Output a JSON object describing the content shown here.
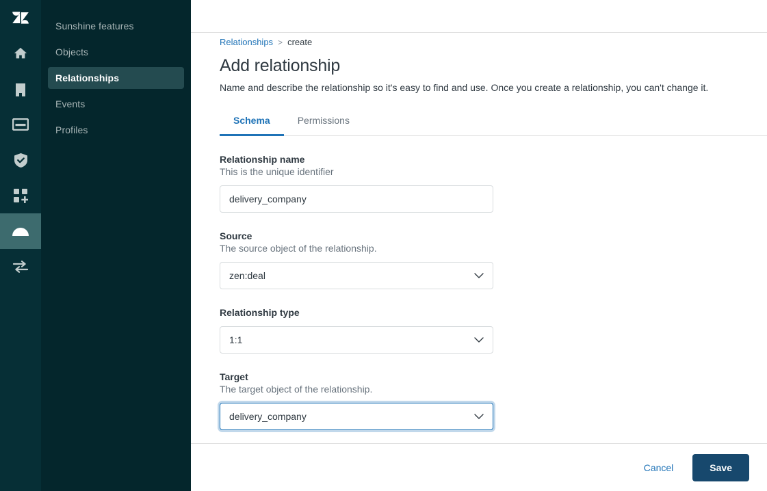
{
  "colors": {
    "rail_bg": "#062f36",
    "nav_bg": "#04262c",
    "nav_active_bg": "#244b50",
    "rail_active_bg": "#3d6b6e",
    "link_blue": "#1f73b7",
    "save_navy": "#17486d",
    "text_dark": "#2f3941",
    "text_muted": "#68737d",
    "border": "#d8dcde"
  },
  "rail": {
    "logo_name": "zendesk-logo",
    "items": [
      {
        "icon": "home-icon",
        "active": false
      },
      {
        "icon": "organization-icon",
        "active": false
      },
      {
        "icon": "card-icon",
        "active": false
      },
      {
        "icon": "shield-check-icon",
        "active": false
      },
      {
        "icon": "apps-add-icon",
        "active": false
      },
      {
        "icon": "sunshine-icon",
        "active": true
      },
      {
        "icon": "arrows-exchange-icon",
        "active": false
      }
    ]
  },
  "sidebar": {
    "items": [
      {
        "label": "Sunshine features",
        "active": false
      },
      {
        "label": "Objects",
        "active": false
      },
      {
        "label": "Relationships",
        "active": true
      },
      {
        "label": "Events",
        "active": false
      },
      {
        "label": "Profiles",
        "active": false
      }
    ]
  },
  "breadcrumb": {
    "link": "Relationships",
    "separator": ">",
    "current": "create"
  },
  "page": {
    "title": "Add relationship",
    "description": "Name and describe the relationship so it's easy to find and use. Once you create a relationship, you can't change it."
  },
  "tabs": [
    {
      "label": "Schema",
      "active": true
    },
    {
      "label": "Permissions",
      "active": false
    }
  ],
  "form": {
    "name_field": {
      "label": "Relationship name",
      "hint": "This is the unique identifier",
      "value": "delivery_company",
      "placeholder": ""
    },
    "source_field": {
      "label": "Source",
      "hint": "The source object of the relationship.",
      "value": "zen:deal"
    },
    "type_field": {
      "label": "Relationship type",
      "hint": "",
      "value": "1:1"
    },
    "target_field": {
      "label": "Target",
      "hint": "The target object of the relationship.",
      "value": "delivery_company",
      "focused": true
    }
  },
  "footer": {
    "cancel_label": "Cancel",
    "save_label": "Save"
  }
}
